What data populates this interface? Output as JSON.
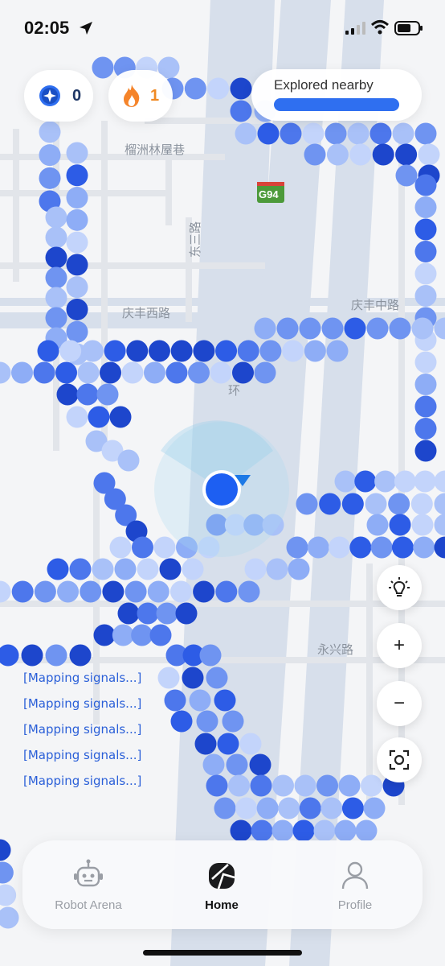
{
  "status_bar": {
    "time": "02:05"
  },
  "top_bar": {
    "badge_count": "0",
    "streak_count": "1",
    "explore_label": "Explored nearby",
    "explore_progress": 1.0
  },
  "map": {
    "roads": [
      {
        "label": "榴洲林屋巷"
      },
      {
        "label": "庆丰西路"
      },
      {
        "label": "庆丰中路"
      },
      {
        "label": "永兴路"
      },
      {
        "label": "东三路"
      },
      {
        "label": "环"
      }
    ],
    "highway_shield": "G94"
  },
  "mapping_log": [
    "[Mapping signals...]",
    "[Mapping signals...]",
    "[Mapping signals...]",
    "[Mapping signals...]",
    "[Mapping signals...]"
  ],
  "controls": {
    "light_icon": "lightbulb-icon",
    "zoom_in": "+",
    "zoom_out": "−",
    "recenter_icon": "recenter-icon"
  },
  "nav": {
    "items": [
      {
        "label": "Robot Arena",
        "icon": "robot-icon",
        "active": false
      },
      {
        "label": "Home",
        "icon": "home-map-icon",
        "active": true
      },
      {
        "label": "Profile",
        "icon": "person-icon",
        "active": false
      }
    ]
  },
  "colors": {
    "accent": "#2f6ff0",
    "streak": "#f08a24",
    "log_text": "#2a5fd8"
  }
}
